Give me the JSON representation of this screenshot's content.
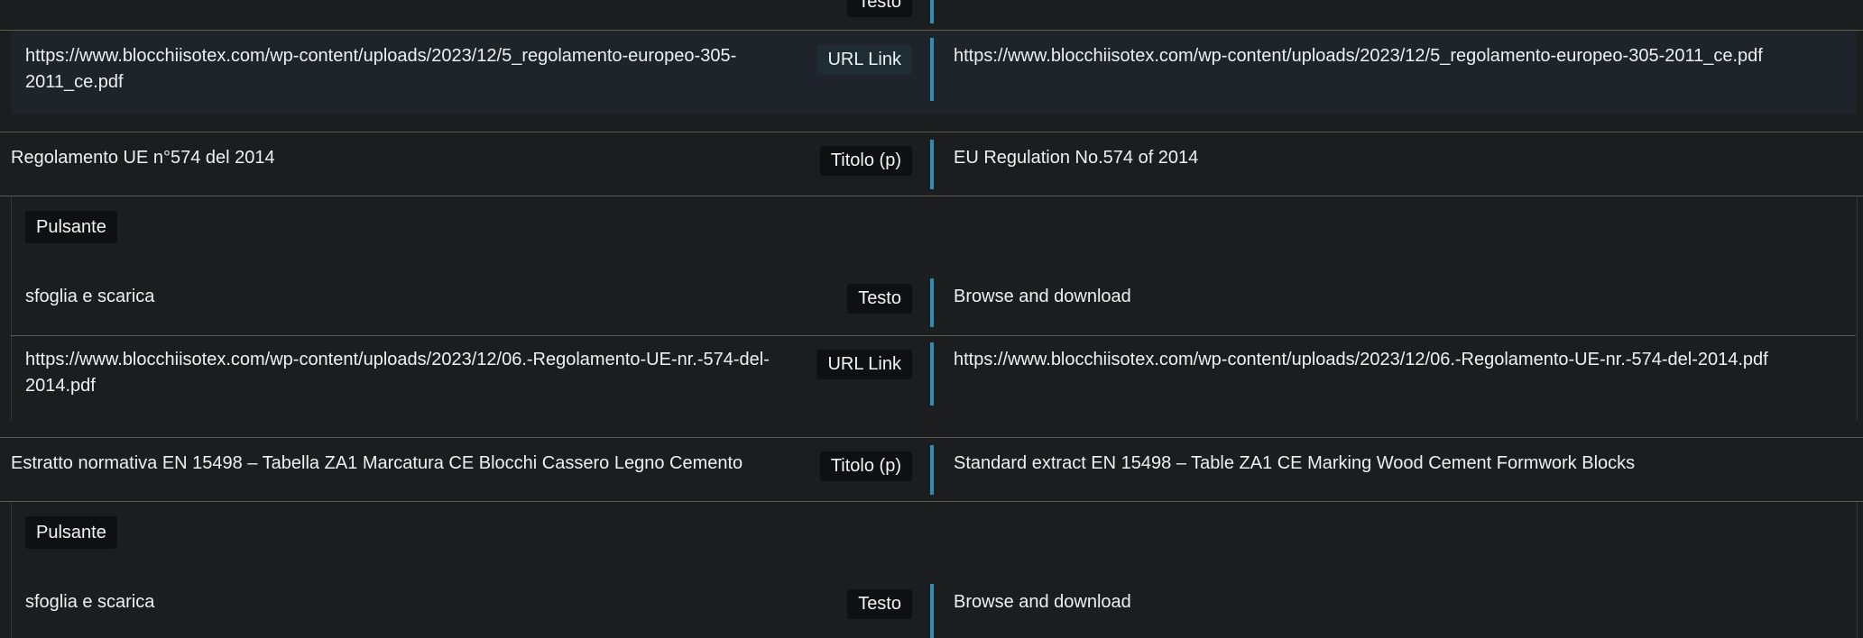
{
  "tags": {
    "text": "Testo",
    "link": "URL Link",
    "title": "Titolo (p)",
    "button": "Pulsante"
  },
  "rows": {
    "url1": {
      "source": "https://www.blocchiisotex.com/wp-content/uploads/2023/12/5_regolamento-europeo-305-2011_ce.pdf",
      "translation": "https://www.blocchiisotex.com/wp-content/uploads/2023/12/5_regolamento-europeo-305-2011_ce.pdf"
    },
    "title2": {
      "source": "Regolamento UE n°574 del 2014",
      "translation": "EU Regulation No.574 of 2014"
    },
    "text2": {
      "source": "sfoglia e scarica",
      "translation": "Browse and download"
    },
    "url2": {
      "source": "https://www.blocchiisotex.com/wp-content/uploads/2023/12/06.-Regolamento-UE-nr.-574-del-2014.pdf",
      "translation": "https://www.blocchiisotex.com/wp-content/uploads/2023/12/06.-Regolamento-UE-nr.-574-del-2014.pdf"
    },
    "title3": {
      "source": "Estratto normativa EN 15498 – Tabella ZA1 Marcatura CE Blocchi Cassero Legno Cemento",
      "translation": "Standard extract EN 15498 – Table ZA1 CE Marking Wood Cement Formwork Blocks"
    },
    "text3": {
      "source": "sfoglia e scarica",
      "translation": "Browse and download"
    }
  },
  "colors": {
    "background": "#1b1d1f",
    "accent_bar": "#2e8fb3",
    "highlight_row": "#1e2429",
    "tag_background": "#0f1011"
  }
}
